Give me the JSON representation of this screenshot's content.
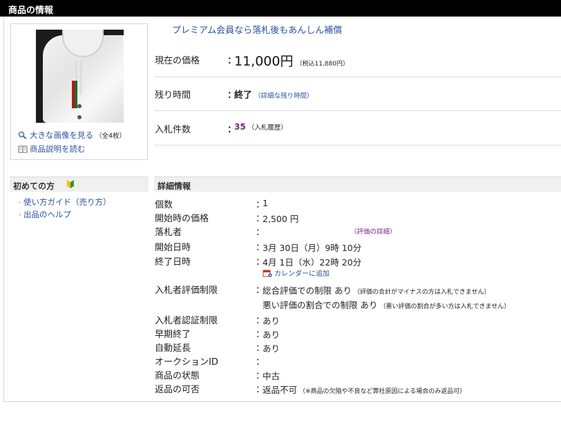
{
  "header": {
    "title": "商品の情報"
  },
  "image_box": {
    "links": [
      {
        "label": "大きな画像を見る",
        "note": "（全4枚）",
        "icon": "magnifier-icon"
      },
      {
        "label": "商品説明を読む",
        "icon": "book-icon"
      }
    ]
  },
  "summary": {
    "premium_link": "プレミアム会員なら落札後もあんしん補償",
    "colon": "：",
    "price": {
      "label": "現在の価格",
      "value": "11,000円",
      "tax": "（税込11,880円）"
    },
    "time": {
      "label": "残り時間",
      "value": "終了",
      "link": "（詳細な残り時間）"
    },
    "bids": {
      "label": "入札件数",
      "value": "35",
      "link": "（入札履歴）"
    }
  },
  "beginner": {
    "title": "初めての方",
    "links": [
      "使い方ガイド（売り方）",
      "出品のヘルプ"
    ]
  },
  "details": {
    "title": "詳細情報",
    "colon": "：",
    "rows": [
      {
        "label": "個数",
        "value": "1"
      },
      {
        "label": "開始時の価格",
        "value": "2,500 円"
      },
      {
        "label": "落札者",
        "value": "",
        "link": "（評価の詳細）"
      },
      {
        "label": "開始日時",
        "value": "3月 30日（月）9時 10分"
      },
      {
        "label": "終了日時",
        "value": "4月 1日（水）22時 20分"
      },
      {
        "label": "入札者評価制限",
        "value": "総合評価での制限 あり",
        "note": "（評価の合計がマイナスの方は入札できません）"
      },
      {
        "label": "",
        "value": "悪い評価の割合での制限 あり",
        "note": "（悪い評価の割合が多い方は入札できません）"
      },
      {
        "label": "入札者認証制限",
        "value": "あり"
      },
      {
        "label": "早期終了",
        "value": "あり"
      },
      {
        "label": "自動延長",
        "value": "あり"
      },
      {
        "label": "オークションID",
        "value": ""
      },
      {
        "label": "商品の状態",
        "value": "中古"
      },
      {
        "label": "返品の可否",
        "value": "返品不可",
        "note": "（※商品の欠陥や不良など弊社原因による場合のみ返品可）"
      }
    ],
    "calendar_link": "カレンダーに追加"
  },
  "colors": {
    "link": "#2b51a2",
    "visited": "#7a2685",
    "header_bg": "#000000"
  }
}
